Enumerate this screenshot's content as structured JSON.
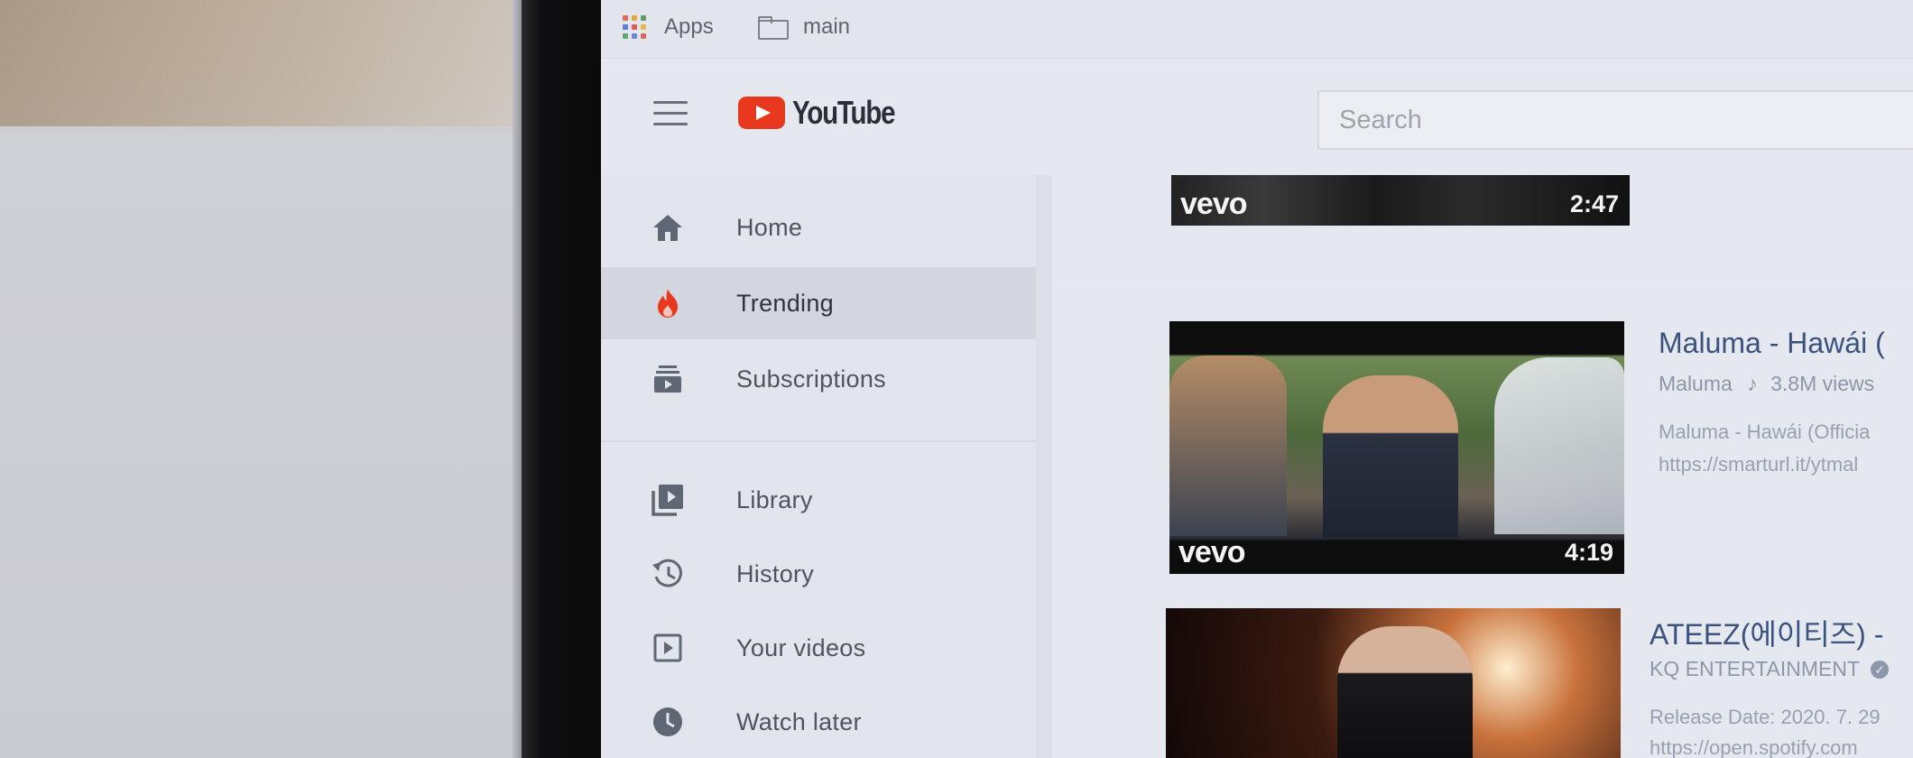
{
  "bookmarks": {
    "apps_label": "Apps",
    "folder_label": "main"
  },
  "header": {
    "brand": "YouTube",
    "search_placeholder": "Search"
  },
  "sidebar": {
    "items": [
      {
        "label": "Home",
        "icon": "home-icon",
        "active": false
      },
      {
        "label": "Trending",
        "icon": "flame-icon",
        "active": true
      },
      {
        "label": "Subscriptions",
        "icon": "subscriptions-icon",
        "active": false
      },
      {
        "label": "Library",
        "icon": "library-icon",
        "active": false
      },
      {
        "label": "History",
        "icon": "history-icon",
        "active": false
      },
      {
        "label": "Your videos",
        "icon": "play-square-icon",
        "active": false
      },
      {
        "label": "Watch later",
        "icon": "clock-icon",
        "active": false
      }
    ]
  },
  "videos": [
    {
      "duration": "2:47",
      "brand": "vevo"
    },
    {
      "title": "Maluma - Hawái (",
      "channel": "Maluma",
      "views": "3.8M views",
      "desc_line1": "Maluma - Hawái (Officia",
      "desc_line2": "https://smarturl.it/ytmal",
      "duration": "4:19",
      "brand": "vevo"
    },
    {
      "title": "ATEEZ(에이티즈) -",
      "channel": "KQ ENTERTAINMENT",
      "desc_line1": "Release Date: 2020. 7. 29",
      "desc_line2": "https://open.spotify.com"
    }
  ],
  "colors": {
    "brand_red": "#e8391f",
    "title_blue": "#39527f"
  }
}
